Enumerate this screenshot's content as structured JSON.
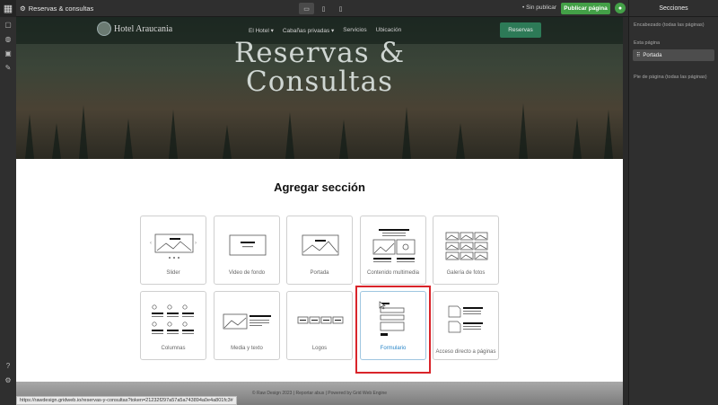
{
  "topbar": {
    "page_name": "Reservas & consultas",
    "unpublished": "• Sin publicar",
    "publish_label": "Publicar página"
  },
  "site": {
    "logo_text": "Hotel Araucania",
    "nav": [
      "El Hotel ▾",
      "Cabañas privadas ▾",
      "Servicios",
      "Ubicación"
    ],
    "nav_button": "Reservas",
    "hero_title_line1": "Reservas &",
    "hero_title_line2": "Consultas"
  },
  "add_section": {
    "title": "Agregar sección",
    "cards": [
      {
        "label": "Slider"
      },
      {
        "label": "Video de fondo"
      },
      {
        "label": "Portada"
      },
      {
        "label": "Contenido multimedia"
      },
      {
        "label": "Galería de fotos"
      },
      {
        "label": "Columnas"
      },
      {
        "label": "Media y texto"
      },
      {
        "label": "Logos"
      },
      {
        "label": "Formulario"
      },
      {
        "label": "Acceso directo a páginas"
      }
    ]
  },
  "footer": {
    "text": "© Raw Design 2023 | Reportar abus | Powered by Grid Web Engine"
  },
  "status_url": "https://rawdesign.gridweb.io/reservas-y-consultas?token=21232f297a57a5a743894a0e4a801fc3#",
  "right_panel": {
    "title": "Secciones",
    "header_label": "Encabezado (todas las páginas)",
    "this_page_label": "Esta página",
    "section_item": "Portada",
    "footer_label": "Pie de página (todas las páginas)"
  },
  "colors": {
    "publish_green": "#43a047",
    "selection_red": "#d9242a",
    "nav_button_green": "#2d7a57"
  }
}
